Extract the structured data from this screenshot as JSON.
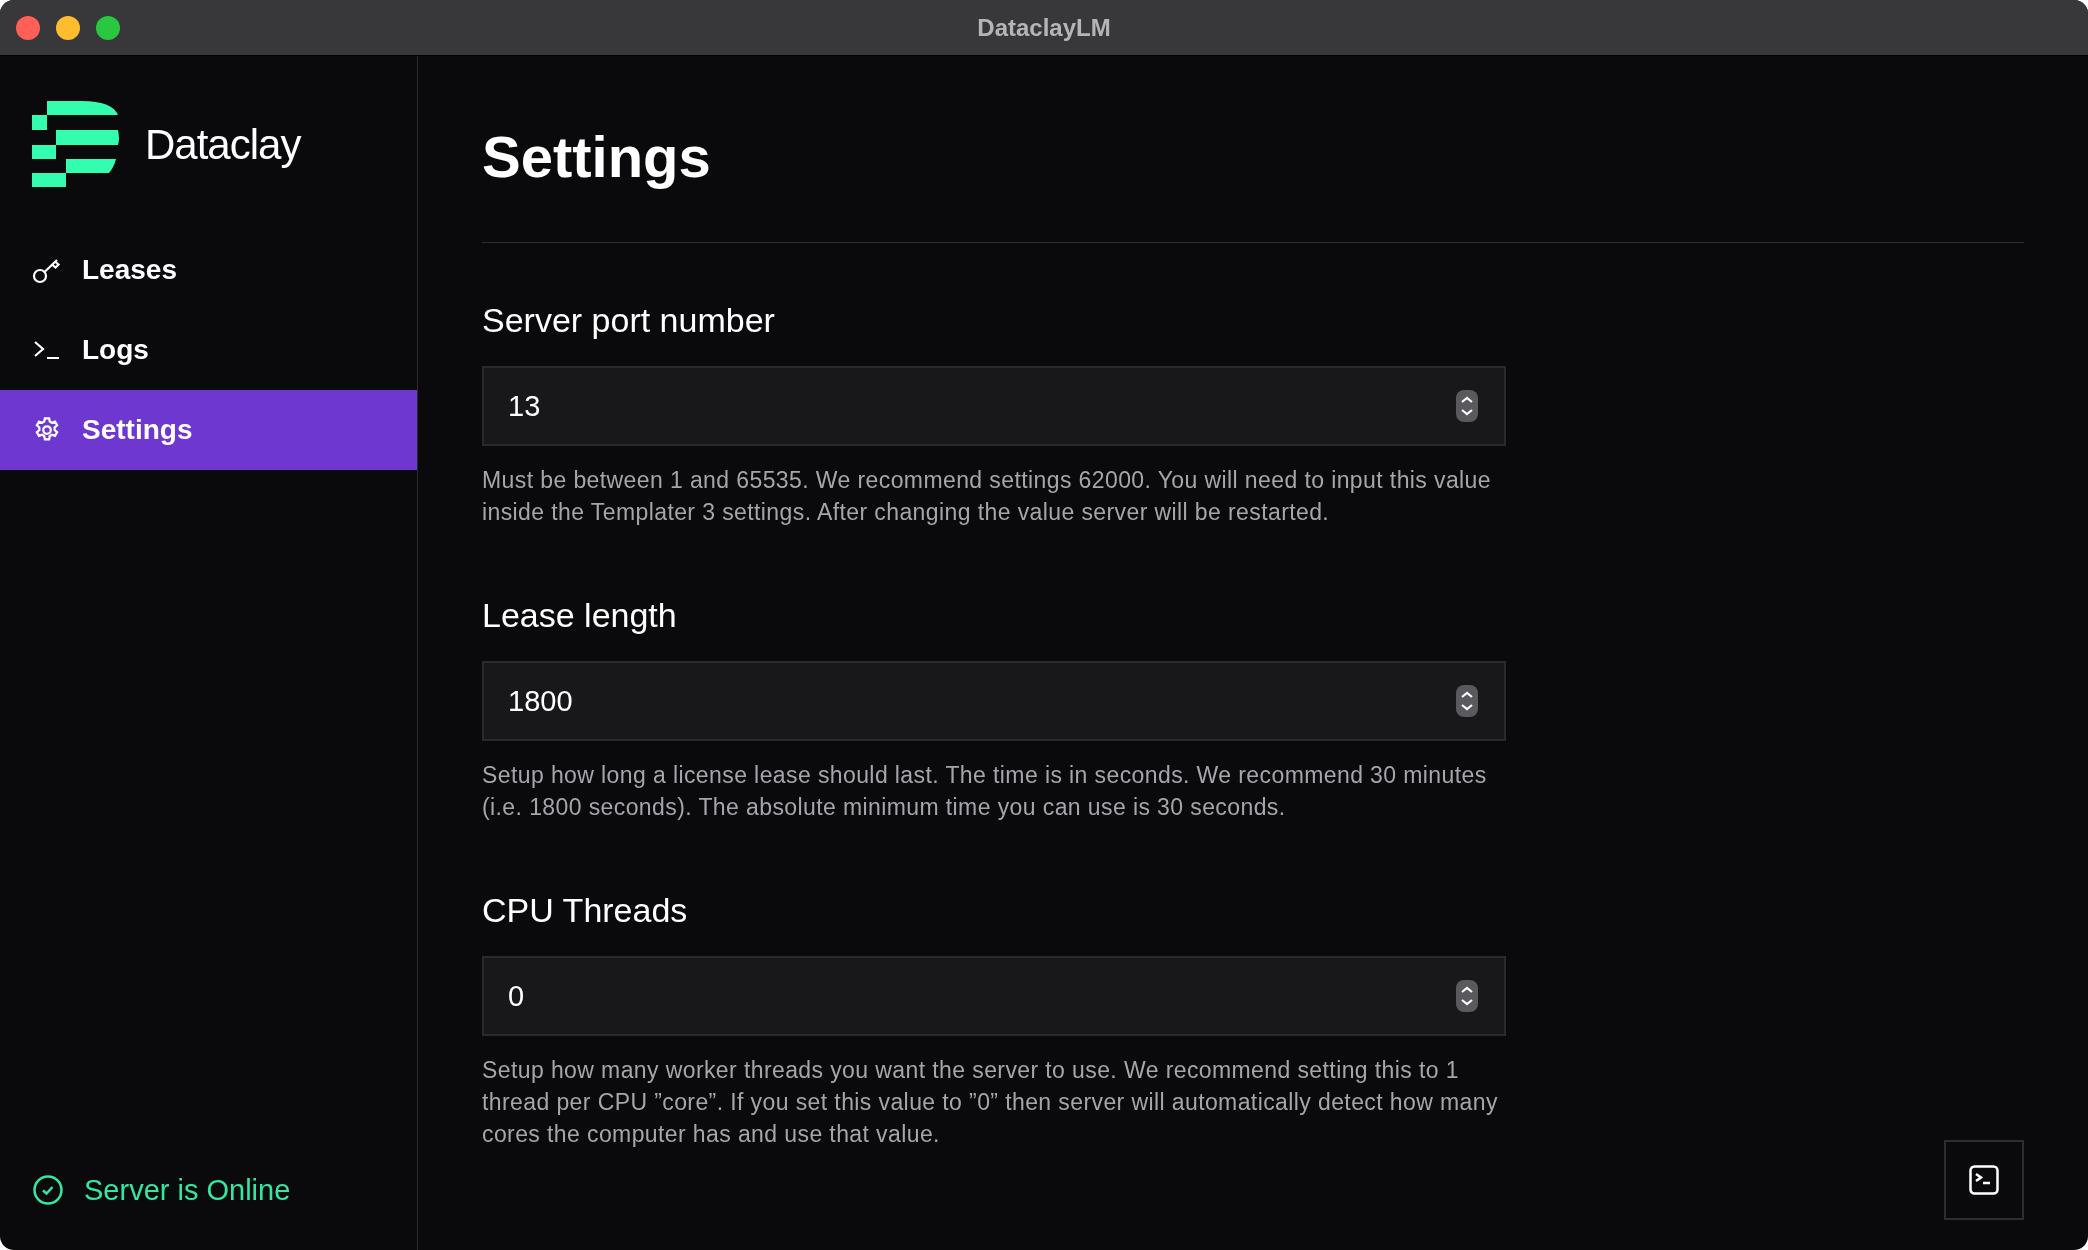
{
  "window": {
    "title": "DataclayLM"
  },
  "sidebar": {
    "brand": "Dataclay",
    "items": [
      {
        "label": "Leases",
        "kind": "leases",
        "selected": false
      },
      {
        "label": "Logs",
        "kind": "logs",
        "selected": false
      },
      {
        "label": "Settings",
        "kind": "settings",
        "selected": true
      }
    ],
    "status": {
      "text": "Server is Online",
      "online": true
    }
  },
  "page": {
    "title": "Settings",
    "settings": [
      {
        "label": "Server port number",
        "value": "13",
        "help": "Must be between 1 and 65535. We recommend settings 62000. You will need to input this value inside the Templater 3 settings. After changing the value server will be restarted."
      },
      {
        "label": "Lease length",
        "value": "1800",
        "help": "Setup how long a license lease should last. The time is in seconds. We recommend 30 minutes (i.e. 1800 seconds). The absolute minimum time you can use is 30 seconds."
      },
      {
        "label": "CPU Threads",
        "value": "0",
        "help": "Setup how many worker threads you want the server to use. We recommend setting this to 1 thread per CPU ”core”. If you set this value to ”0” then server will automatically detect how many cores the computer has and use that value."
      }
    ]
  }
}
